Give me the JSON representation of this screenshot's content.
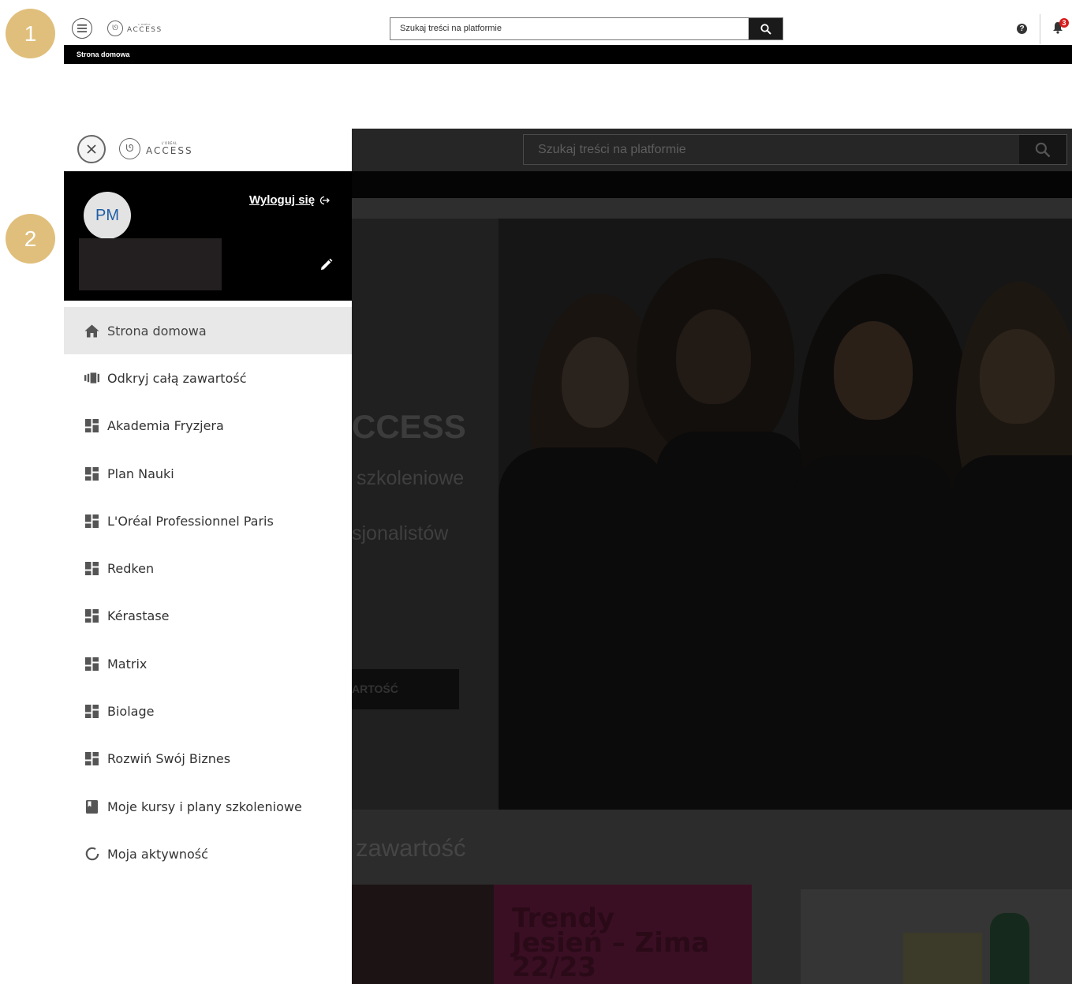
{
  "steps": [
    "1",
    "2"
  ],
  "header": {
    "logo_text": "ACCESS",
    "logo_small": "L'ORÉAL",
    "search_placeholder": "Szukaj treści na platformie",
    "notification_count": "3",
    "breadcrumb": "Strona domowa"
  },
  "sidemenu": {
    "logo_text": "ACCESS",
    "logo_small": "L'ORÉAL",
    "avatar_initials": "PM",
    "logout_label": "Wyloguj się",
    "items": [
      {
        "label": "Strona domowa",
        "icon": "home-icon",
        "active": true
      },
      {
        "label": "Odkryj całą zawartość",
        "icon": "library-icon"
      },
      {
        "label": "Akademia Fryzjera",
        "icon": "dashboard-icon"
      },
      {
        "label": "Plan Nauki",
        "icon": "dashboard-icon"
      },
      {
        "label": "L'Oréal Professionnel Paris",
        "icon": "dashboard-icon"
      },
      {
        "label": "Redken",
        "icon": "dashboard-icon"
      },
      {
        "label": "Kérastase",
        "icon": "dashboard-icon"
      },
      {
        "label": "Matrix",
        "icon": "dashboard-icon"
      },
      {
        "label": "Biolage",
        "icon": "dashboard-icon"
      },
      {
        "label": "Rozwiń Swój Biznes",
        "icon": "dashboard-icon"
      },
      {
        "label": "Moje kursy i plany szkoleniowe",
        "icon": "book-icon"
      },
      {
        "label": "Moja aktywność",
        "icon": "activity-icon"
      }
    ]
  },
  "background_page": {
    "search_placeholder": "Szukaj treści na platformie",
    "hero_title": "CCESS",
    "hero_line1": "szkoleniowe",
    "hero_line2": "sjonalistów",
    "hero_button": "ARTOŚĆ",
    "section_title": "zawartość",
    "card1_title": "Trendy\nJesień – Zima\n22/23"
  },
  "colors": {
    "step_badge": "#e0bf7c",
    "notification_badge": "#d81c1c",
    "avatar_text": "#1e5ea8",
    "active_item_bg": "#e8e8e8"
  }
}
